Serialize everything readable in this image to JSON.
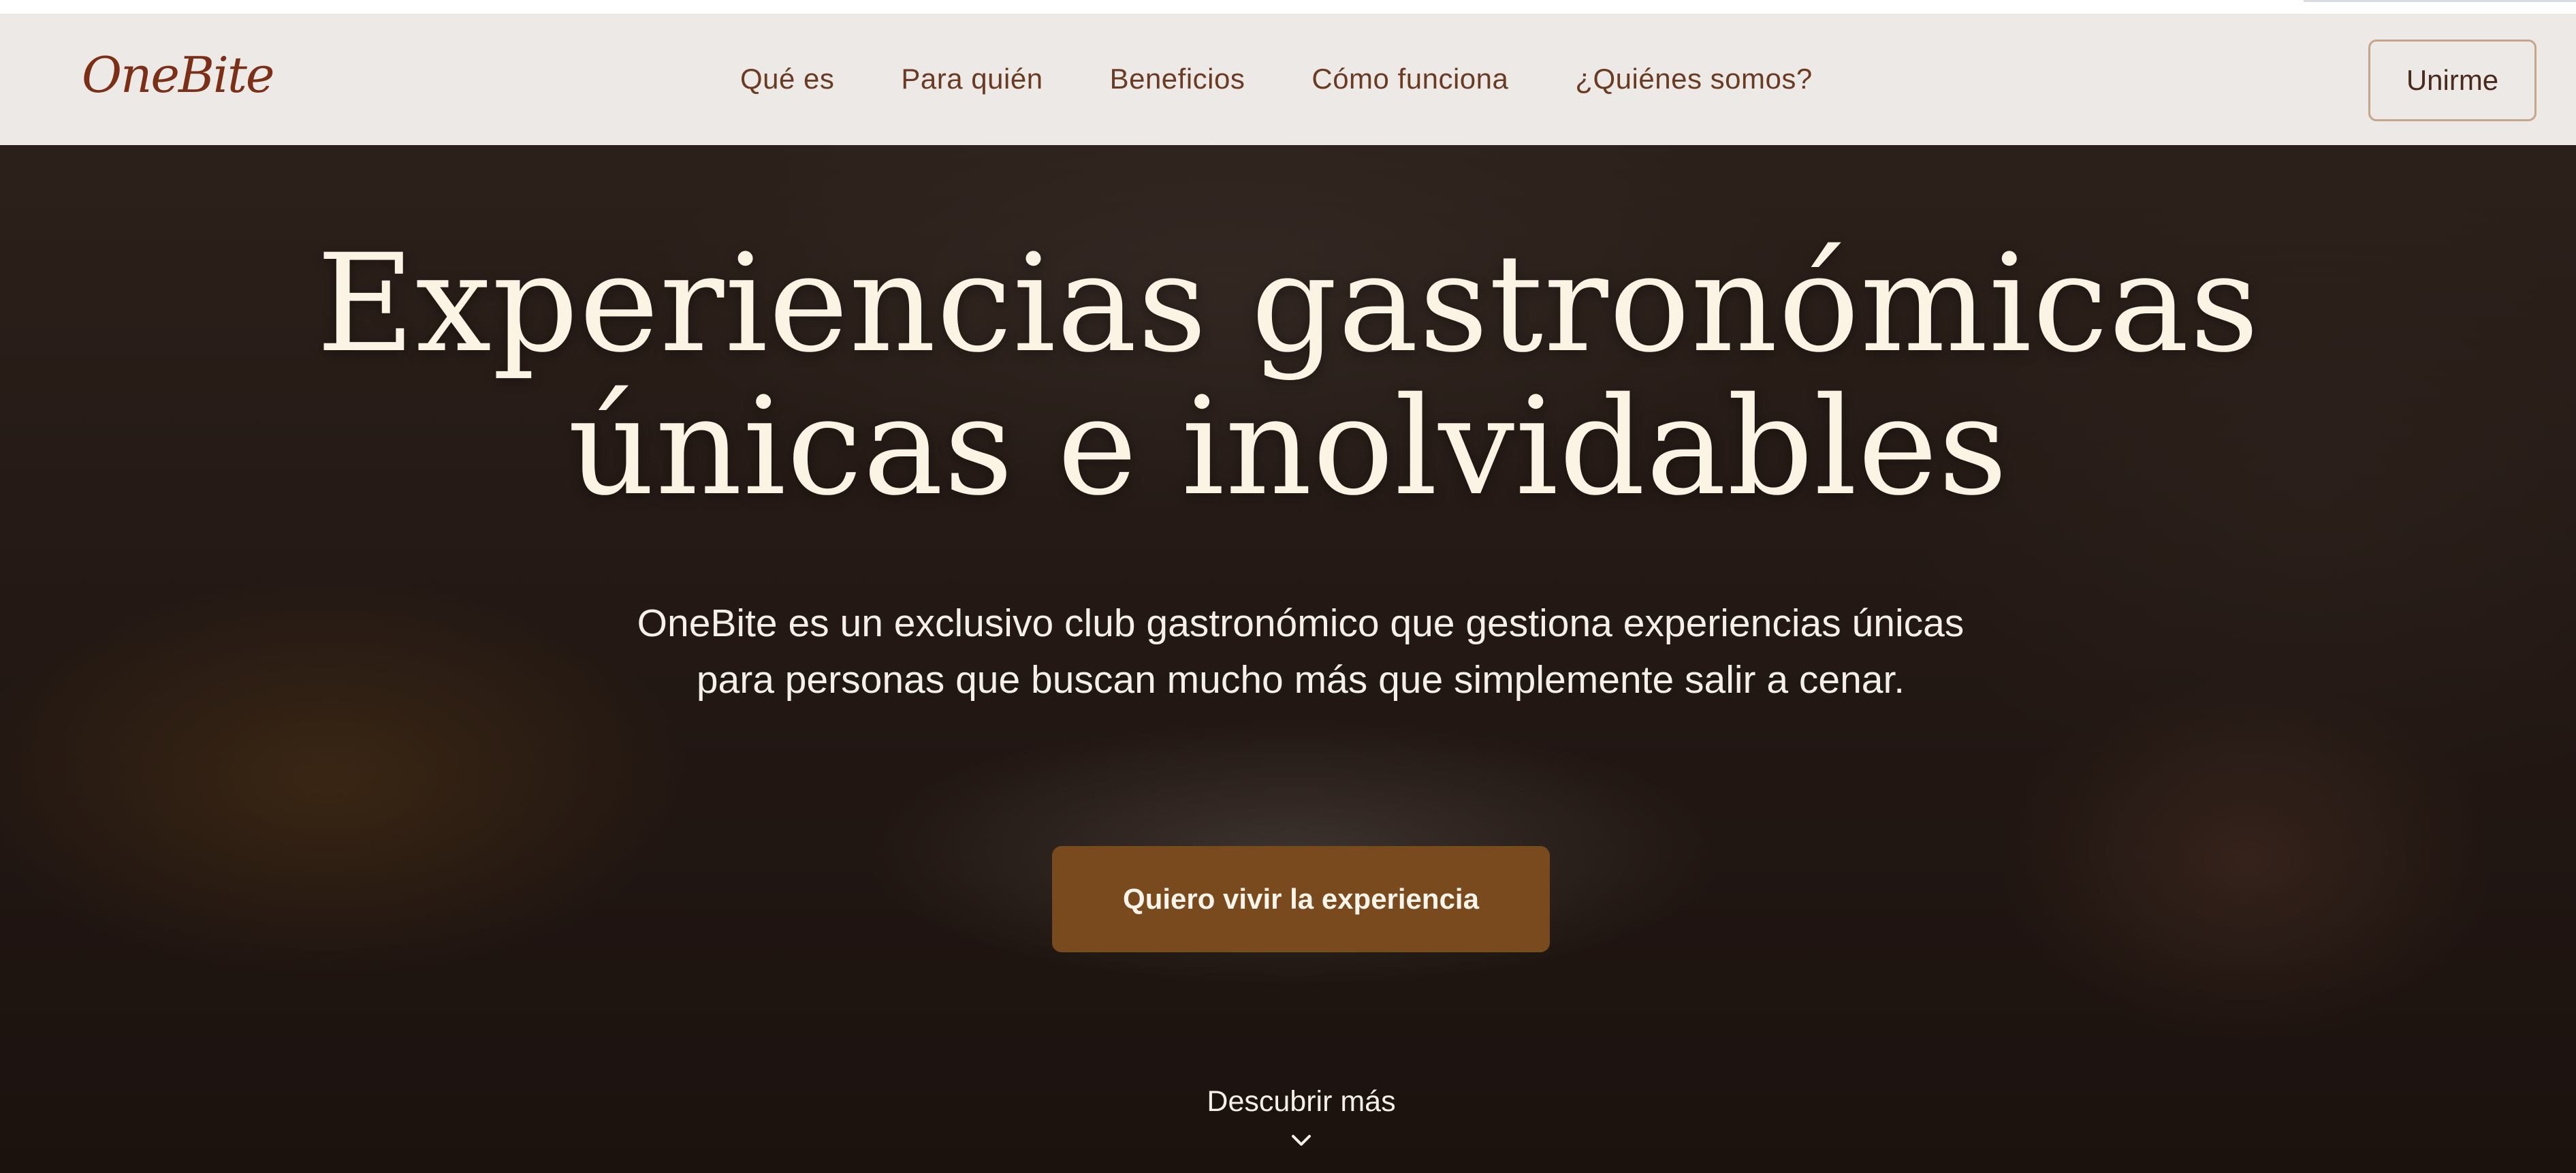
{
  "header": {
    "logo_text": "OneBite",
    "nav": [
      {
        "label": "Qué es"
      },
      {
        "label": "Para quién"
      },
      {
        "label": "Beneficios"
      },
      {
        "label": "Cómo funciona"
      },
      {
        "label": "¿Quiénes somos?"
      }
    ],
    "join_label": "Unirme"
  },
  "hero": {
    "title_line1": "Experiencias gastronómicas",
    "title_line2": "únicas e inolvidables",
    "subtitle": "OneBite es un exclusivo club gastronómico que gestiona experiencias únicas para personas que buscan mucho más que simplemente salir a cenar.",
    "cta_label": "Quiero vivir la experiencia",
    "discover_label": "Descubrir más",
    "discover_icon": "chevron-down-icon"
  },
  "colors": {
    "brand": "#7a2f16",
    "cta": "#7a4a1f",
    "header_bg": "#ece9e7",
    "title_text": "#fbf4e4"
  }
}
